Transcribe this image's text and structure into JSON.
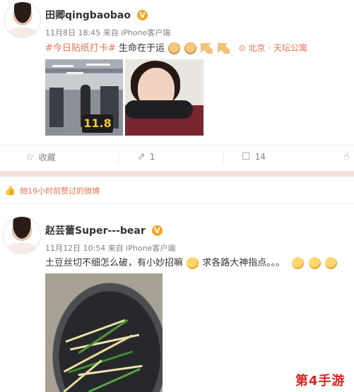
{
  "post1": {
    "username": "田卿qingbaobao",
    "verified_badge": "V",
    "meta": "11月8日 18:45 来自 iPhone客户端",
    "topic": "#今日贴纸打卡#",
    "text": "生命在于运",
    "emojis": [
      "fist-emoji",
      "fist-emoji",
      "muscle-emoji",
      "muscle-emoji"
    ],
    "location_icon": "location-pin-icon",
    "location": "北京 · 天坛公寓",
    "stamp": "11.8",
    "actions": {
      "favorite_label": "收藏",
      "share_count": "1",
      "comment_count": "14"
    }
  },
  "liked_notice": {
    "icon": "thumbs-up-icon",
    "text": "她19小时前赞过的微博"
  },
  "post2": {
    "username": "赵芸蕾Super---bear",
    "verified_badge": "V",
    "meta": "11月12日 10:54 来自 iPhone客户端",
    "text_part1": "土豆丝切不细怎么破，有小妙招嘛",
    "text_part2": "求各路大神指点。。。",
    "emojis": [
      "thinking-emoji",
      "drooling-emoji",
      "drooling-emoji",
      "drooling-emoji"
    ]
  },
  "watermark": "第4手游",
  "colors": {
    "accent": "#eb7350",
    "badge": "#f5a623",
    "band": "#f7dce0",
    "watermark": "#d8231f"
  }
}
